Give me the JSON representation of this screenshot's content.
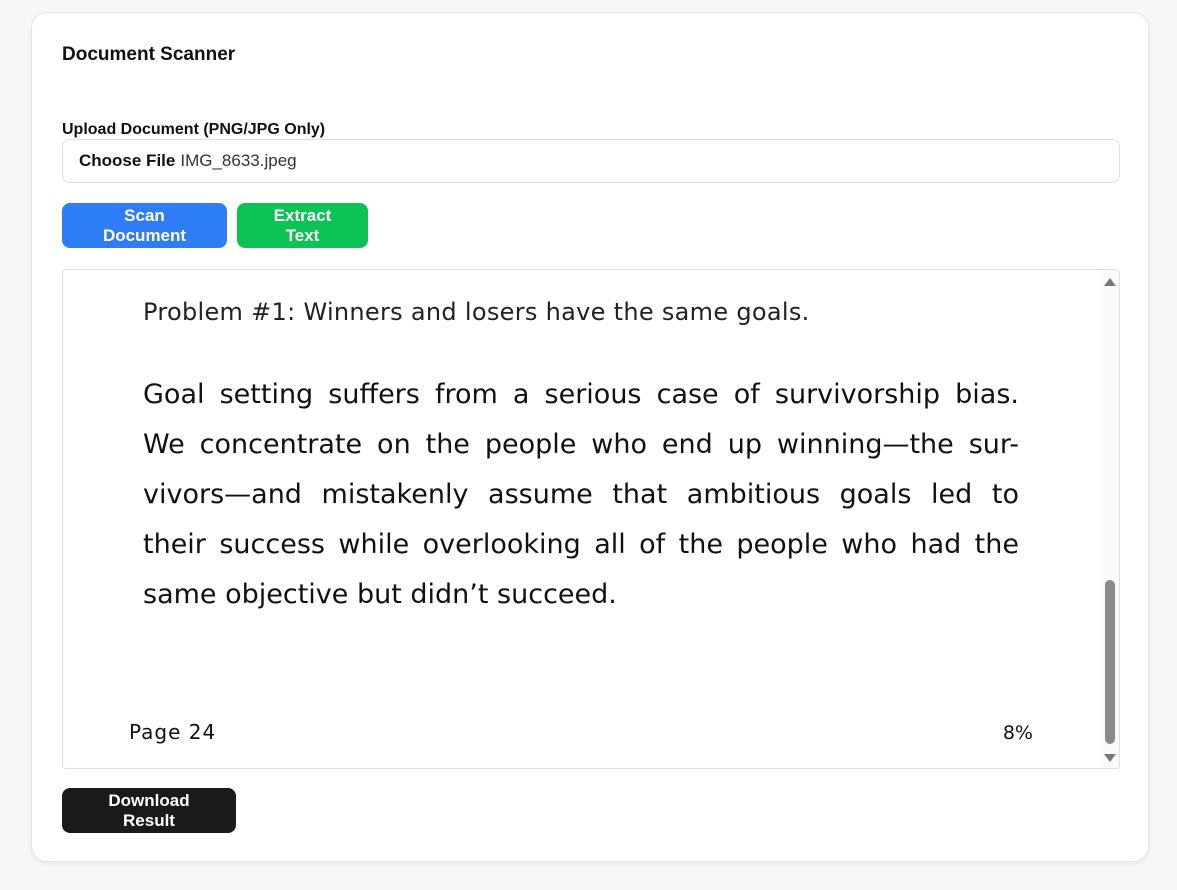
{
  "app": {
    "title": "Document Scanner"
  },
  "upload": {
    "label": "Upload Document (PNG/JPG Only)",
    "choose_label": "Choose File",
    "file_name": "IMG_8633.jpeg"
  },
  "actions": {
    "scan_label": "Scan Document",
    "extract_label": "Extract Text",
    "download_label": "Download Result"
  },
  "colors": {
    "scan_button": "#2f7df6",
    "extract_button": "#0cc254",
    "download_button": "#1a1a1a"
  },
  "preview": {
    "heading": "Problem #1: Winners and losers have the same goals.",
    "lines": [
      "Goal setting suffers from a serious case of survivorship bias.",
      "We concentrate on the people who end up winning—the sur-",
      "vivors—and mistakenly assume that ambitious goals led to",
      "their success while overlooking all of the people who had the",
      "same objective but didn’t succeed."
    ],
    "page_label": "Page 24",
    "progress": "8%"
  }
}
